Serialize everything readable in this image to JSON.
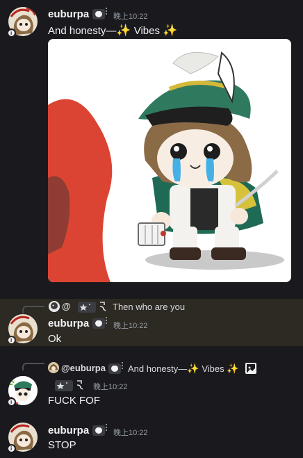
{
  "messages": [
    {
      "id": "m1",
      "username": "euburpa",
      "time": "晚上10:22",
      "text_prefix": "And honesty—",
      "sparkle": "✨",
      "text_middle": " Vibes ",
      "has_image": true
    },
    {
      "id": "m2",
      "reply": {
        "name": "@",
        "text": "Then who are you"
      },
      "username": "euburpa",
      "time": "晚上10:22",
      "text": "Ok"
    },
    {
      "id": "m3",
      "reply": {
        "name": "@euburpa",
        "text_prefix": "And honesty—",
        "text_middle": " Vibes "
      },
      "time": "晚上10:22",
      "text": "FUCK FOF"
    },
    {
      "id": "m4",
      "username": "euburpa",
      "time": "晚上10:22",
      "text": "STOP"
    }
  ],
  "colors": {
    "background": "#1a1a1e",
    "highlight": "#2d2923",
    "username": "#f2f3f5",
    "timestamp": "#949ba4",
    "sparkle": "#f0c53a"
  },
  "icons": [
    "avatar-chibi",
    "heart-badge",
    "sparkle-emoji",
    "image-attachment-icon",
    "reply-curve",
    "star-tag",
    "arrow-tag"
  ]
}
